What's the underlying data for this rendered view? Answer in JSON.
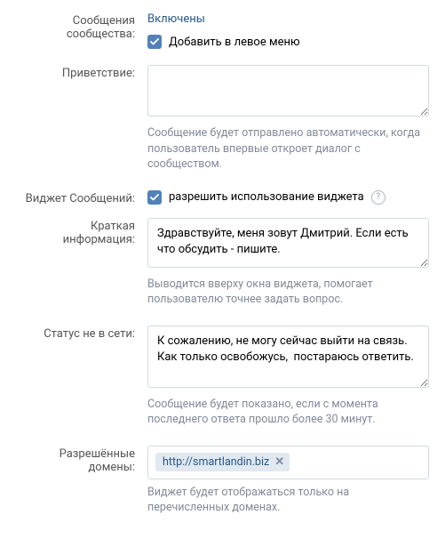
{
  "messages": {
    "label": "Сообщения сообщества:",
    "value": "Включены",
    "add_to_menu_label": "Добавить в левое меню"
  },
  "greeting": {
    "label": "Приветствие:",
    "value": "",
    "help": "Сообщение будет отправлено автоматически, когда пользователь впервые откроет диалог с сообществом."
  },
  "widget": {
    "label": "Виджет Сообщений:",
    "checkbox_label": "разрешить использование виджета"
  },
  "short_info": {
    "label": "Краткая информация:",
    "value": "Здравствуйте, меня зовут Дмитрий. Если есть что обсудить - пишите.",
    "help": "Выводится вверху окна виджета, помогает пользователю точнее задать вопрос."
  },
  "offline": {
    "label": "Статус не в сети:",
    "value": "К сожалению, не могу сейчас выйти на связь. Как только освобожусь,  постараюсь ответить.",
    "help": "Сообщение будет показано, если с момента последнего ответа прошло более 30 минут."
  },
  "domains": {
    "label": "Разрешённые домены:",
    "tokens": [
      "http://smartlandin.biz"
    ],
    "help": "Виджет будет отображаться только на перечисленных доменах."
  }
}
